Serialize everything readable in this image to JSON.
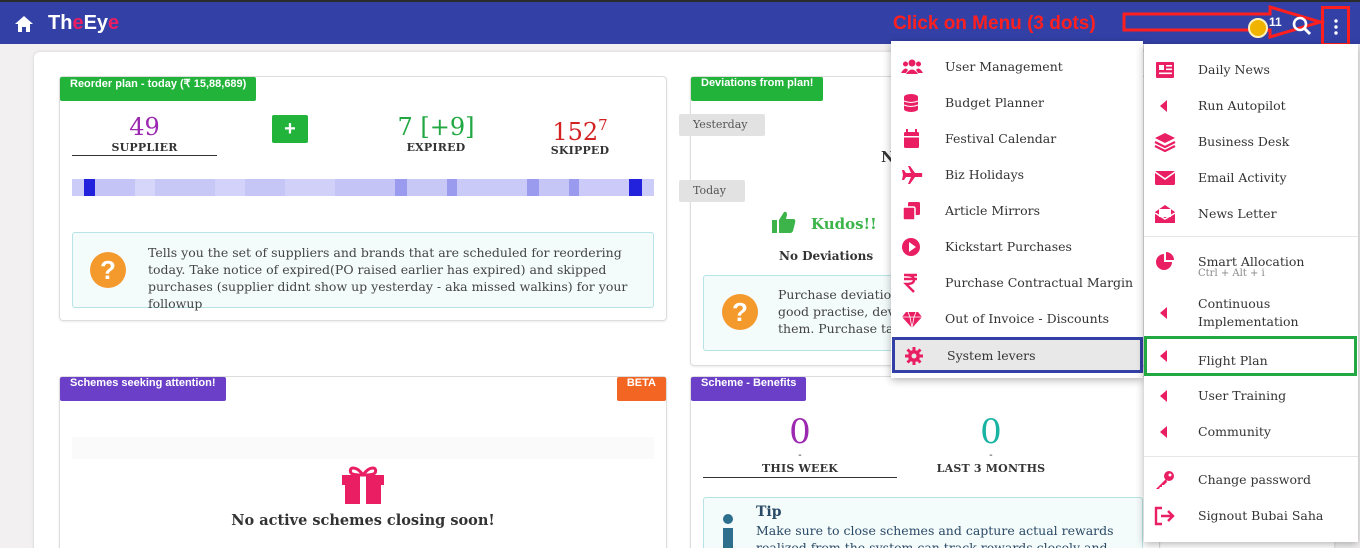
{
  "app": {
    "logo_a": "Th",
    "logo_b": "e",
    "logo_c": "Ey",
    "logo_d": "e",
    "coins": "11"
  },
  "annotation": {
    "instruction": "Click on Menu (3 dots)"
  },
  "reorder": {
    "title": "Reorder plan - today (₹ 15,88,689)",
    "supplier_num": "49",
    "supplier_lbl": "SUPPLIER",
    "plus": "+",
    "expired_num": "7 [+9]",
    "expired_lbl": "EXPIRED",
    "skipped_num": "152",
    "skipped_sup": "7",
    "skipped_lbl": "SKIPPED",
    "info": "Tells you the set of suppliers and brands that are scheduled for reordering today. Take notice of expired(PO raised earlier has expired) and skipped purchases (supplier didnt show up yesterday - aka missed walkins) for your followup"
  },
  "deviations": {
    "title": "Deviations from plan!",
    "yesterday": "Yesterday",
    "n_letter": "N",
    "today": "Today",
    "kudos": "Kudos!!",
    "no_dev": "No Deviations",
    "info": "Purchase deviations good practise, deviat them. Purchase tags"
  },
  "schemes": {
    "title": "Schemes seeking attention!",
    "beta": "BETA",
    "empty": "No active schemes closing soon!"
  },
  "benefits": {
    "title": "Scheme - Benefits",
    "week_num": "0",
    "week_dash": "-",
    "week_lbl": "THIS WEEK",
    "months_num": "0",
    "months_dash": "-",
    "months_lbl": "LAST 3 MONTHS",
    "tip_title": "Tip",
    "tip_text": "Make sure to close schemes and capture actual rewards realized from the system can track rewards closely and keep you informed"
  },
  "menu_left": [
    {
      "label": "User Management",
      "icon": "users-icon"
    },
    {
      "label": "Budget Planner",
      "icon": "coins-icon"
    },
    {
      "label": "Festival Calendar",
      "icon": "calendar-icon"
    },
    {
      "label": "Biz Holidays",
      "icon": "plane-icon"
    },
    {
      "label": "Article Mirrors",
      "icon": "copy-icon"
    },
    {
      "label": "Kickstart Purchases",
      "icon": "play-icon"
    },
    {
      "label": "Purchase Contractual Margin",
      "icon": "rupee-icon"
    },
    {
      "label": "Out of Invoice - Discounts",
      "icon": "gem-icon"
    },
    {
      "label": "System levers",
      "icon": "gear-icon"
    }
  ],
  "menu_right": [
    {
      "label": "Daily News",
      "icon": "newspaper-icon"
    },
    {
      "label": "Run Autopilot",
      "icon": "caret-left-icon"
    },
    {
      "label": "Business Desk",
      "icon": "layers-icon"
    },
    {
      "label": "Email Activity",
      "icon": "envelope-icon"
    },
    {
      "label": "News Letter",
      "icon": "envelope-open-icon"
    },
    {
      "label": "Smart Allocation",
      "sub": "Ctrl + Alt + i",
      "icon": "pie-chart-icon"
    },
    {
      "label": "Continuous",
      "label2": "Implementation",
      "icon": "caret-left-icon"
    },
    {
      "label": "Flight Plan",
      "icon": "caret-left-icon"
    },
    {
      "label": "User Training",
      "icon": "caret-left-icon"
    },
    {
      "label": "Community",
      "icon": "caret-left-icon"
    },
    {
      "label": "Change password",
      "icon": "key-icon"
    },
    {
      "label": "Signout Bubai Saha",
      "icon": "sign-out-icon"
    }
  ],
  "colors": {
    "topbar": "#3341a7",
    "accent_pink": "#e91e63",
    "highlight_red": "#ff1f1f",
    "highlight_blue": "#3341a7",
    "highlight_green": "#22a843"
  }
}
